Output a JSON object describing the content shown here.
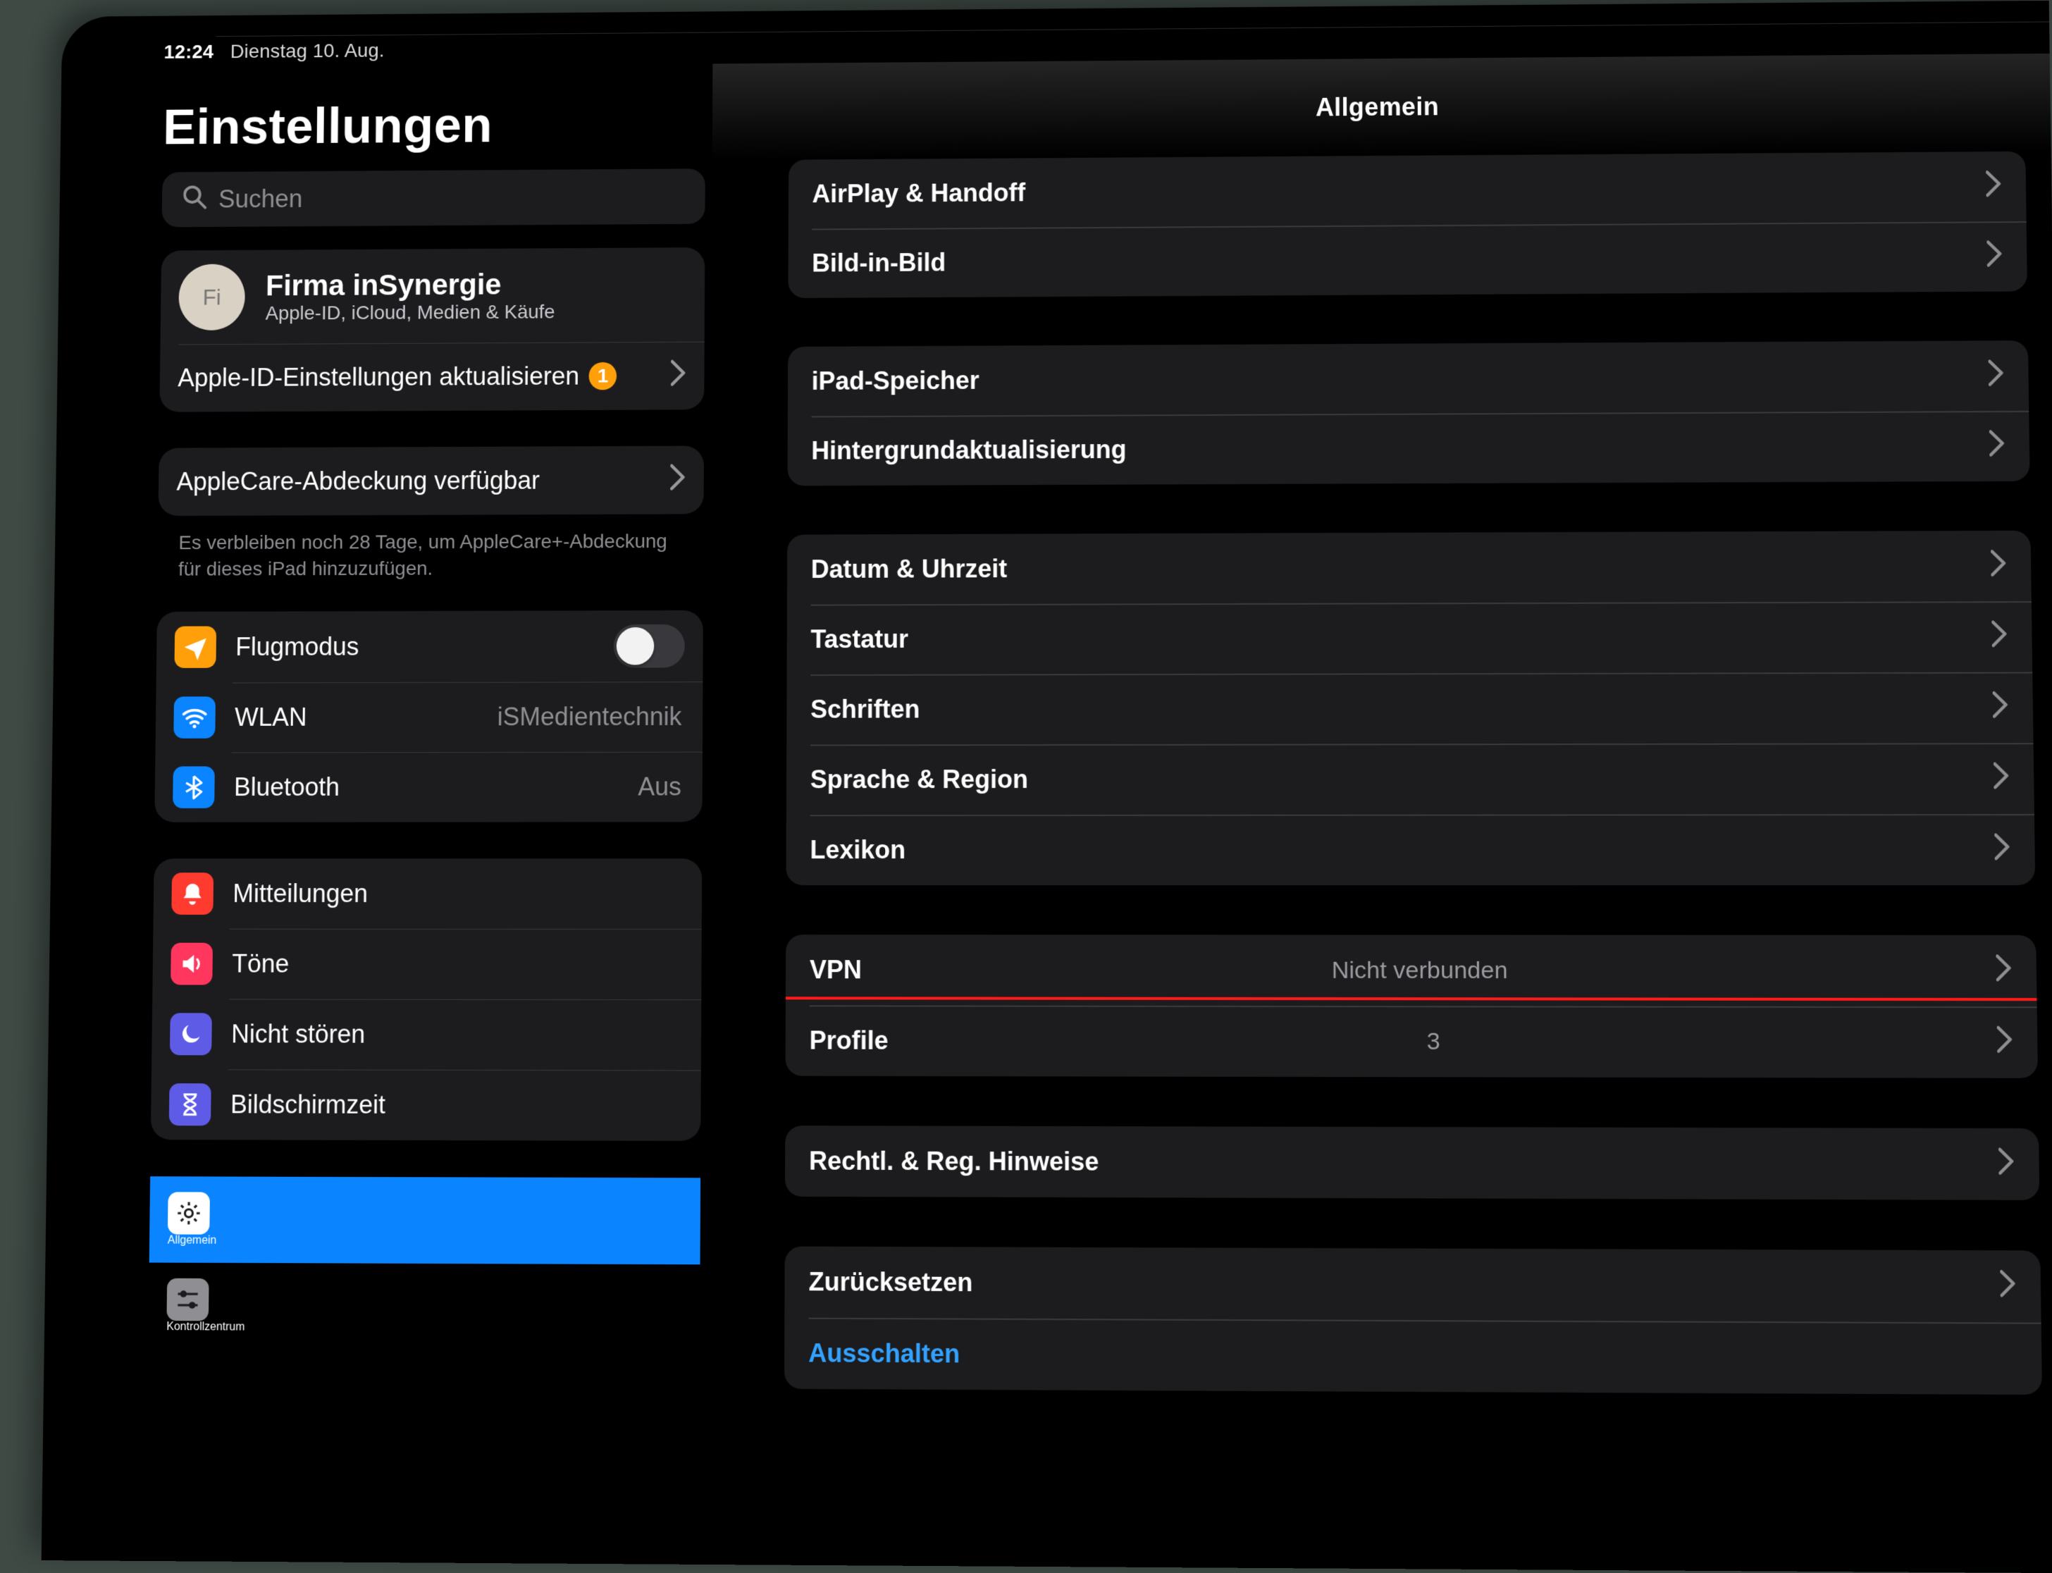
{
  "status": {
    "time": "12:24",
    "date": "Dienstag 10. Aug."
  },
  "sidebar": {
    "title": "Einstellungen",
    "search_placeholder": "Suchen",
    "account": {
      "initials": "Fi",
      "name": "Firma inSynergie",
      "sub": "Apple-ID, iCloud, Medien & Käufe"
    },
    "appleid_update": {
      "label": "Apple-ID-Einstellungen aktualisieren",
      "badge": "1"
    },
    "applecare": {
      "label": "AppleCare-Abdeckung verfügbar",
      "footnote": "Es verbleiben noch 28 Tage, um AppleCare+-Abdeckung für dieses iPad hinzuzufügen."
    },
    "net": {
      "airplane": "Flugmodus",
      "wlan": "WLAN",
      "wlan_val": "iSMedientechnik",
      "bt": "Bluetooth",
      "bt_val": "Aus"
    },
    "group2": {
      "notif": "Mitteilungen",
      "sound": "Töne",
      "dnd": "Nicht stören",
      "screentime": "Bildschirmzeit"
    },
    "group3": {
      "general": "Allgemein",
      "cc": "Kontrollzentrum"
    }
  },
  "detail": {
    "title": "Allgemein",
    "g1": {
      "airplay": "AirPlay & Handoff",
      "pip": "Bild-in-Bild"
    },
    "g2": {
      "storage": "iPad-Speicher",
      "bgref": "Hintergrundaktualisierung"
    },
    "g3": {
      "date": "Datum & Uhrzeit",
      "kb": "Tastatur",
      "fonts": "Schriften",
      "lang": "Sprache & Region",
      "dict": "Lexikon"
    },
    "g4": {
      "vpn": "VPN",
      "vpn_val": "Nicht verbunden",
      "profiles": "Profile",
      "profiles_val": "3"
    },
    "g5": {
      "legal": "Rechtl. & Reg. Hinweise"
    },
    "g6": {
      "reset": "Zurücksetzen",
      "shutdown": "Ausschalten"
    }
  }
}
